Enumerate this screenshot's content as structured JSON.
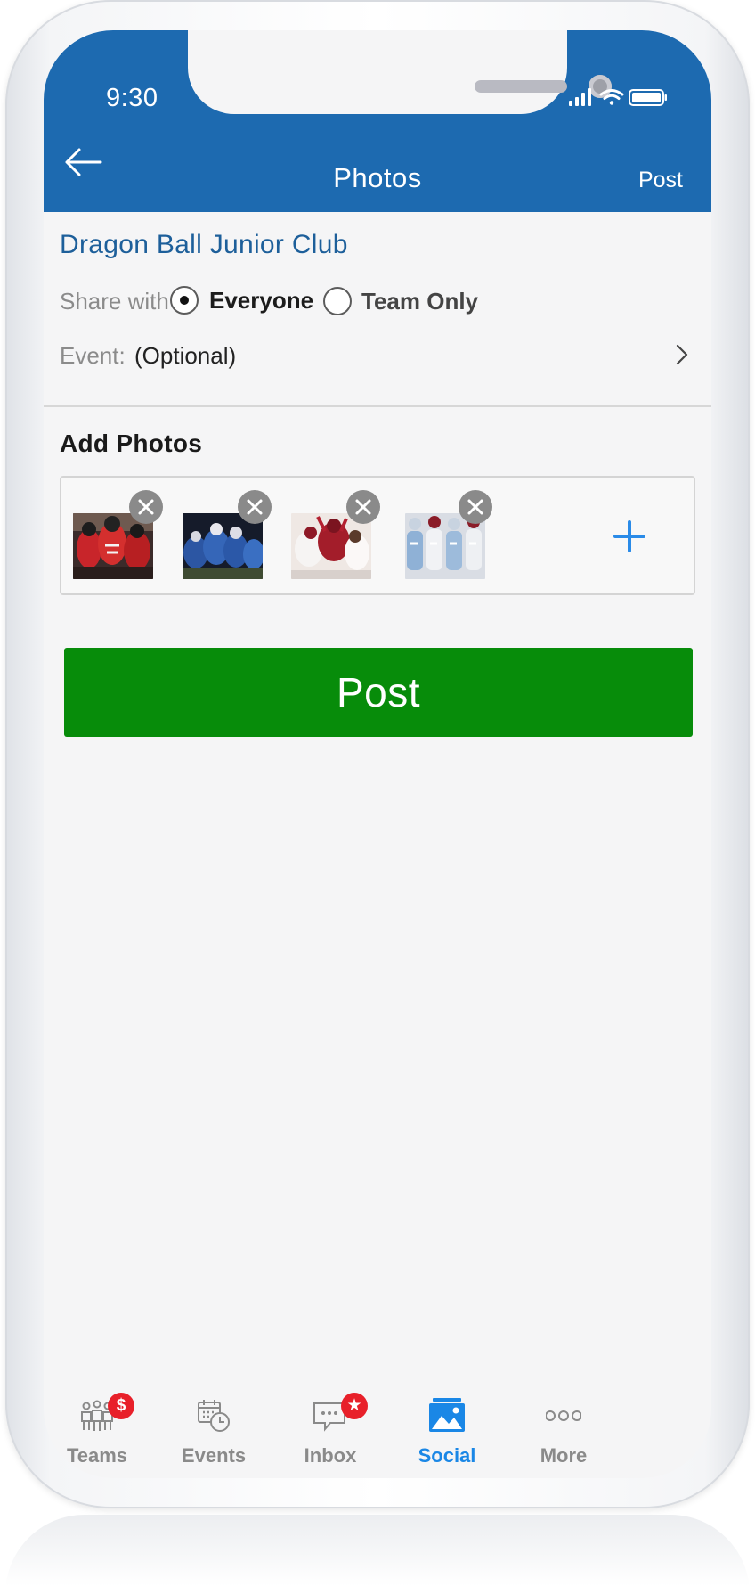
{
  "status_bar": {
    "time": "9:30"
  },
  "nav": {
    "title": "Photos",
    "post_label": "Post"
  },
  "club_name": "Dragon Ball Junior Club",
  "share": {
    "label": "Share with",
    "options": [
      {
        "label": "Everyone",
        "selected": true
      },
      {
        "label": "Team Only",
        "selected": false
      }
    ]
  },
  "event": {
    "label": "Event:",
    "value": "(Optional)"
  },
  "photos": {
    "title": "Add Photos",
    "items": [
      {
        "icon": "football-team-red-photo"
      },
      {
        "icon": "football-team-blue-photo"
      },
      {
        "icon": "football-huddle-photo"
      },
      {
        "icon": "football-lineup-photo"
      }
    ],
    "add_icon": "plus-icon"
  },
  "post_button": {
    "label": "Post",
    "color": "#078c0a"
  },
  "tabs": [
    {
      "label": "Teams",
      "icon": "teams-icon",
      "badge": "$",
      "active": false
    },
    {
      "label": "Events",
      "icon": "calendar-clock-icon",
      "badge": "",
      "active": false
    },
    {
      "label": "Inbox",
      "icon": "chat-icon",
      "badge": "★",
      "active": false
    },
    {
      "label": "Social",
      "icon": "photo-icon",
      "badge": "",
      "active": true
    },
    {
      "label": "More",
      "icon": "more-dots-icon",
      "badge": "",
      "active": false
    }
  ],
  "colors": {
    "header": "#1d6ab0",
    "accent": "#1a87e6",
    "club_text": "#1d5f9a",
    "badge": "#e8202a"
  }
}
